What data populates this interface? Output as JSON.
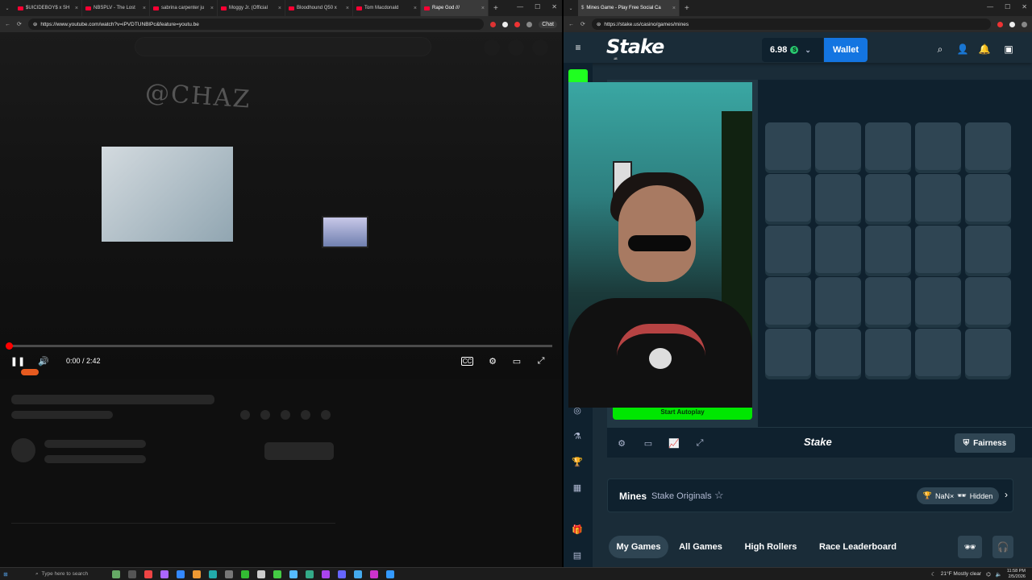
{
  "left_browser": {
    "tabs": [
      {
        "label": "$UICIDEBOY$ x SH"
      },
      {
        "label": "NBSPLV - The Lost"
      },
      {
        "label": "sabrina carpenter ju"
      },
      {
        "label": "Moggy Jr. (Official"
      },
      {
        "label": "Bloodhound Q50 x"
      },
      {
        "label": "Tom Macdonald"
      },
      {
        "label": "Rape God ///"
      }
    ],
    "url": "https://www.youtube.com/watch?v=iPVDTUNBlPc&feature=youtu.be",
    "chat_label": "Chat",
    "player": {
      "time": "0:00 / 2:42",
      "progress": 0.006
    }
  },
  "right_browser": {
    "tab_title": "Mines Game - Play Free Social Ca",
    "url": "https://stake.us/casino/games/mines",
    "stake": {
      "logo": "Stake",
      "logo_sub": ".us",
      "balance": "6.98",
      "coin": "S",
      "wallet_label": "Wallet",
      "start_autoplay": "Start Autoplay",
      "toolbar_logo": "Stake",
      "fairness_label": "Fairness",
      "game_title": "Mines",
      "game_subtitle": "Stake Originals",
      "pill_text": "NaN×",
      "pill_hidden": "Hidden",
      "bottom_tabs": [
        "My Games",
        "All Games",
        "High Rollers",
        "Race Leaderboard"
      ],
      "board_rows": 5,
      "board_cols": 5
    }
  },
  "taskbar": {
    "search_placeholder": "Type here to search",
    "weather": "21°F  Mostly clear",
    "time": "11:58 PM",
    "date": "2/5/2026"
  },
  "colors": {
    "stake_bg": "#1a2c38",
    "stake_dark": "#0f212e",
    "tile": "#2f4553",
    "wallet_blue": "#1475e1",
    "start_green": "#00e701",
    "yt_red": "#ff0033"
  }
}
